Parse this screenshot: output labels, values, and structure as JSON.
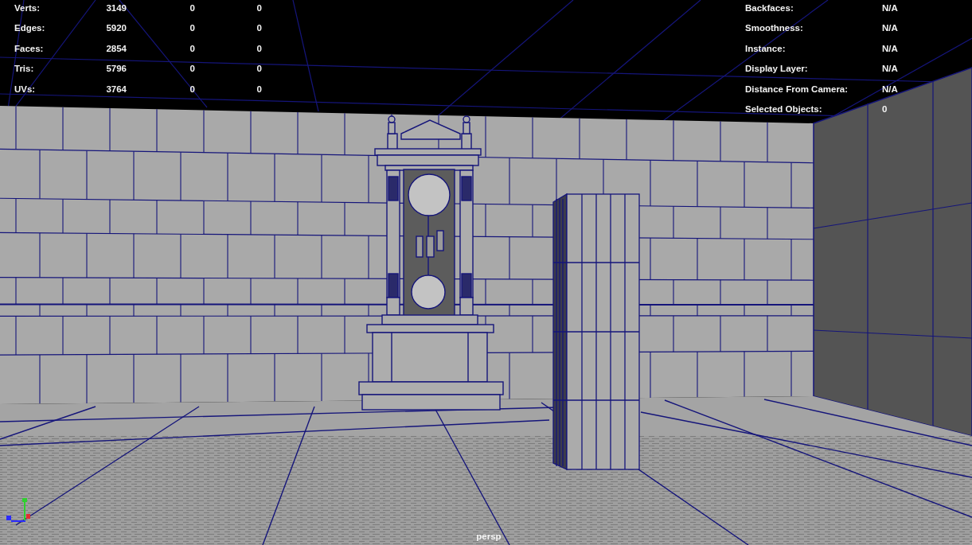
{
  "viewport": {
    "camera": "persp"
  },
  "poly_count": {
    "rows": [
      {
        "label": "Verts:",
        "values": [
          "3149",
          "0",
          "0"
        ]
      },
      {
        "label": "Edges:",
        "values": [
          "5920",
          "0",
          "0"
        ]
      },
      {
        "label": "Faces:",
        "values": [
          "2854",
          "0",
          "0"
        ]
      },
      {
        "label": "Tris:",
        "values": [
          "5796",
          "0",
          "0"
        ]
      },
      {
        "label": "UVs:",
        "values": [
          "3764",
          "0",
          "0"
        ]
      }
    ]
  },
  "object_details": {
    "rows": [
      {
        "label": "Backfaces:",
        "value": "N/A"
      },
      {
        "label": "Smoothness:",
        "value": "N/A"
      },
      {
        "label": "Instance:",
        "value": "N/A"
      },
      {
        "label": "Display Layer:",
        "value": "N/A"
      },
      {
        "label": "Distance From Camera:",
        "value": "N/A"
      },
      {
        "label": "Selected Objects:",
        "value": "0"
      }
    ]
  }
}
